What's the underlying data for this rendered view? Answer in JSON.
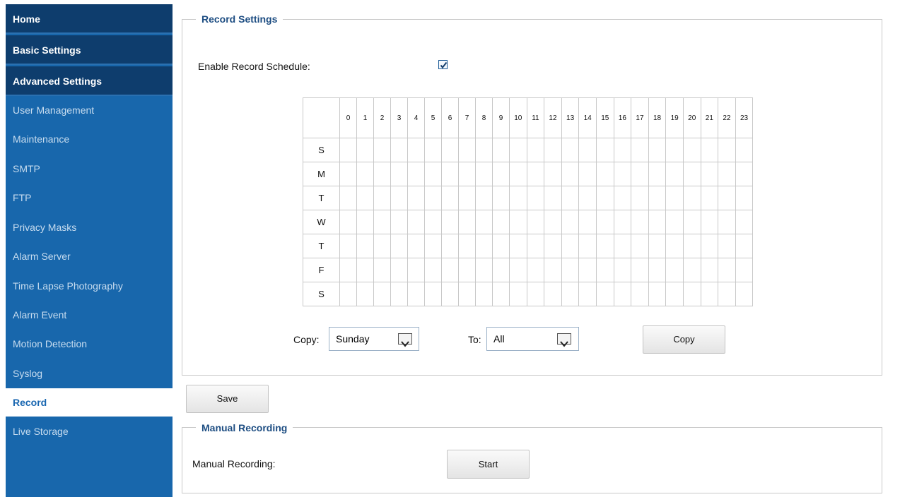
{
  "sidebar": {
    "top_items": [
      "Home",
      "Basic Settings",
      "Advanced Settings"
    ],
    "items": [
      "User Management",
      "Maintenance",
      "SMTP",
      "FTP",
      "Privacy Masks",
      "Alarm Server",
      "Time Lapse Photography",
      "Alarm Event",
      "Motion Detection",
      "Syslog",
      "Record",
      "Live Storage"
    ],
    "active": "Record"
  },
  "record_settings": {
    "legend": "Record Settings",
    "enable_label": "Enable Record Schedule:",
    "enable_checked": true,
    "schedule": {
      "hours": [
        "0",
        "1",
        "2",
        "3",
        "4",
        "5",
        "6",
        "7",
        "8",
        "9",
        "10",
        "11",
        "12",
        "13",
        "14",
        "15",
        "16",
        "17",
        "18",
        "19",
        "20",
        "21",
        "22",
        "23"
      ],
      "days": [
        "S",
        "M",
        "T",
        "W",
        "T",
        "F",
        "S"
      ]
    },
    "copy_label": "Copy:",
    "copy_from_value": "Sunday",
    "to_label": "To:",
    "copy_to_value": "All",
    "copy_button": "Copy"
  },
  "save_button": "Save",
  "manual_recording": {
    "legend": "Manual Recording",
    "label": "Manual Recording:",
    "start_button": "Start"
  },
  "colors": {
    "sidebar_bg": "#1867ac",
    "sidebar_top_bg": "#0e3d6d",
    "active_text": "#1866b0",
    "legend_text": "#1d4d82"
  }
}
